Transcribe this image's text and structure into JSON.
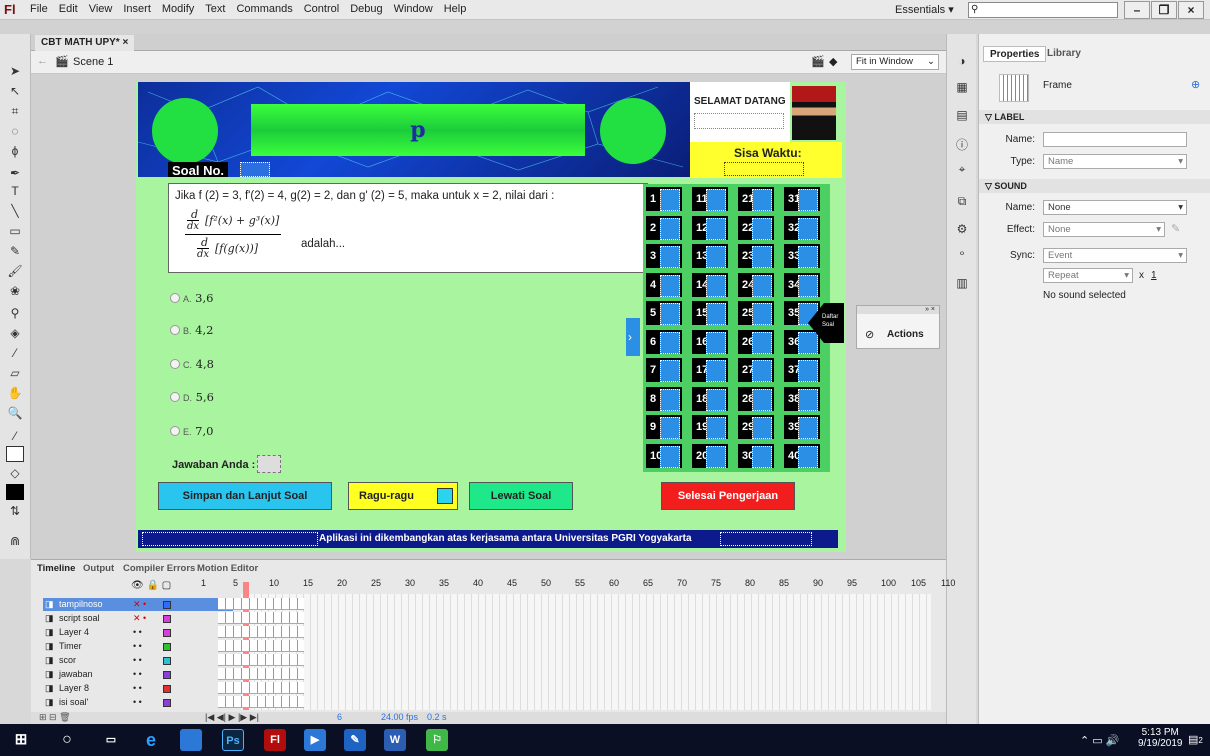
{
  "menubar": {
    "logo": "Fl",
    "items": [
      "File",
      "Edit",
      "View",
      "Insert",
      "Modify",
      "Text",
      "Commands",
      "Control",
      "Debug",
      "Window",
      "Help"
    ],
    "workspace": "Essentials",
    "search_placeholder": ""
  },
  "document": {
    "tab_title": "CBT MATH UPY*",
    "close": "×",
    "scene": "Scene 1",
    "zoom": "Fit in Window"
  },
  "quiz": {
    "title_letter": "p",
    "soal_no": "Soal No.",
    "welcome": "SELAMAT DATANG",
    "time_label": "Sisa Waktu:",
    "question_text": "Jika f (2) = 3, f'(2) = 4, g(2) = 2, dan g' (2) = 5, maka untuk x = 2, nilai dari :",
    "question_tail": "adalah...",
    "frac_num_d": "d",
    "frac_dx": "dx",
    "frac_num_expr": "[f²(x) + g³(x)]",
    "frac_den_expr": "[f(g(x))]",
    "options": [
      {
        "letter": "A.",
        "value": "3,6"
      },
      {
        "letter": "B.",
        "value": "4,2"
      },
      {
        "letter": "C.",
        "value": "4,8"
      },
      {
        "letter": "D.",
        "value": "5,6"
      },
      {
        "letter": "E.",
        "value": "7,0"
      }
    ],
    "answer_label": "Jawaban Anda :",
    "btn_next": "Simpan dan Lanjut Soal",
    "btn_doubt": "Ragu-ragu",
    "btn_skip": "Lewati Soal",
    "btn_finish": "Selesai Pengerjaan",
    "daftar": "Daftar Soal",
    "numbers": [
      1,
      11,
      21,
      31,
      2,
      12,
      22,
      32,
      3,
      13,
      23,
      33,
      4,
      14,
      24,
      34,
      5,
      15,
      25,
      35,
      6,
      16,
      26,
      36,
      7,
      17,
      27,
      37,
      8,
      18,
      28,
      38,
      9,
      19,
      29,
      39,
      10,
      20,
      30,
      40
    ],
    "footer": "Aplikasi ini dikembangkan atas kerjasama antara Universitas PGRI Yogyakarta"
  },
  "actions_panel": {
    "label": "Actions"
  },
  "properties": {
    "tab_properties": "Properties",
    "tab_library": "Library",
    "frame_label": "Frame",
    "section_label": "LABEL",
    "name_label": "Name:",
    "type_label": "Type:",
    "type_value": "Name",
    "section_sound": "SOUND",
    "sound_name_label": "Name:",
    "sound_name_value": "None",
    "effect_label": "Effect:",
    "effect_value": "None",
    "sync_label": "Sync:",
    "sync_value": "Event",
    "repeat_value": "Repeat",
    "repeat_x": "x",
    "repeat_count": "1",
    "no_sound": "No sound selected"
  },
  "timeline": {
    "tabs": [
      "Timeline",
      "Output",
      "Compiler Errors",
      "Motion Editor"
    ],
    "ruler": [
      "1",
      "5",
      "10",
      "15",
      "20",
      "25",
      "30",
      "35",
      "40",
      "45",
      "50",
      "55",
      "60",
      "65",
      "70",
      "75",
      "80",
      "85",
      "90",
      "95",
      "100",
      "105",
      "110"
    ],
    "layers": [
      {
        "name": "tampilnoso",
        "color": "#2e6bff"
      },
      {
        "name": "script soal",
        "color": "#d640d6"
      },
      {
        "name": "Layer 4",
        "color": "#d640d6"
      },
      {
        "name": "Timer",
        "color": "#30c030"
      },
      {
        "name": "scor",
        "color": "#2ec0d0"
      },
      {
        "name": "jawaban",
        "color": "#8a3fd6"
      },
      {
        "name": "Layer 8",
        "color": "#e03030"
      },
      {
        "name": "isi soal'",
        "color": "#8a3fd6"
      }
    ],
    "frame_num": "6",
    "fps": "24.00",
    "fps_unit": "fps",
    "time": "0.2 s"
  },
  "taskbar": {
    "time": "5:13 PM",
    "date": "9/19/2019",
    "notif": "2"
  }
}
